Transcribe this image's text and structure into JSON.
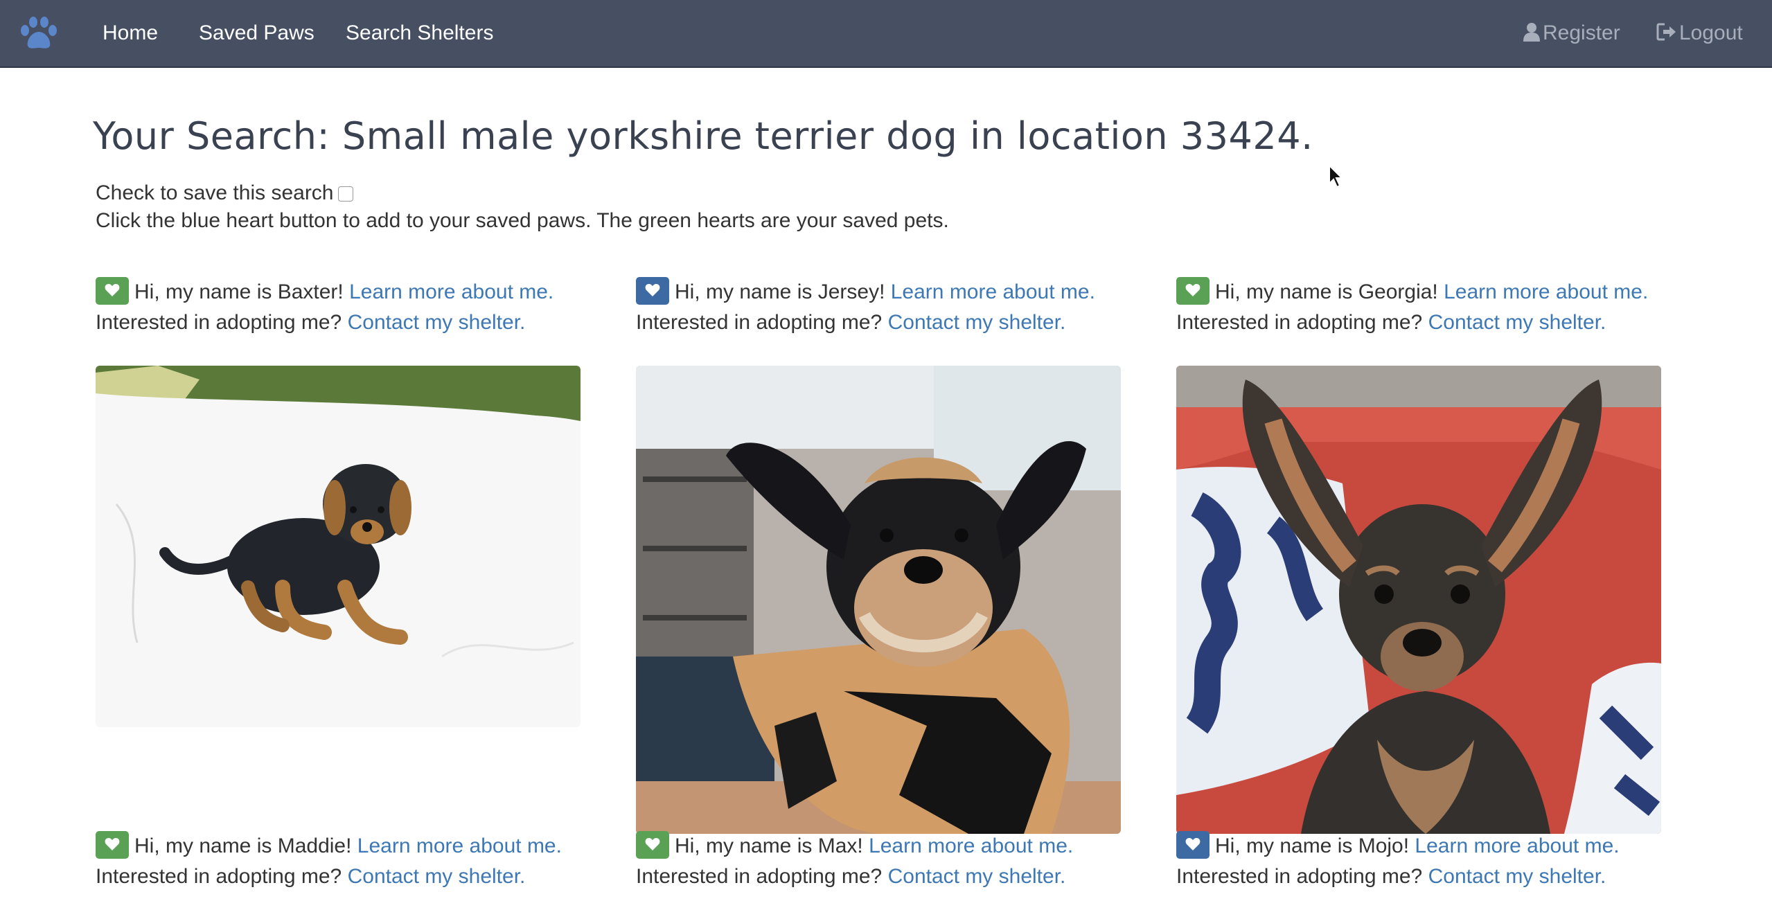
{
  "nav": {
    "items": [
      {
        "label": "Home"
      },
      {
        "label": "Saved Paws"
      },
      {
        "label": "Search Shelters"
      }
    ],
    "register_label": "Register",
    "logout_label": "Logout"
  },
  "search": {
    "title": "Your Search: Small male yorkshire terrier dog in location 33424.",
    "save_label": "Check to save this search",
    "save_checked": false,
    "instructions": "Click the blue heart button to add to your saved paws. The green hearts are your saved pets."
  },
  "common": {
    "learn_more": "Learn more about me.",
    "adopt_prompt": "Interested in adopting me?",
    "contact": "Contact my shelter."
  },
  "pets": [
    {
      "greeting": "Hi, my name is Baxter!",
      "saved": true,
      "heart_color": "#5aa156",
      "photo": "puppy lying on white blanket"
    },
    {
      "greeting": "Hi, my name is Jersey!",
      "saved": false,
      "heart_color": "#3e6aa3",
      "photo": "shaggy black and tan terrier"
    },
    {
      "greeting": "Hi, my name is Georgia!",
      "saved": true,
      "heart_color": "#5aa156",
      "photo": "terrier on red couch"
    },
    {
      "greeting": "Hi, my name is Maddie!",
      "saved": true,
      "heart_color": "#5aa156"
    },
    {
      "greeting": "Hi, my name is Max!",
      "saved": true,
      "heart_color": "#5aa156"
    },
    {
      "greeting": "Hi, my name is Mojo!",
      "saved": false,
      "heart_color": "#3e6aa3"
    }
  ],
  "colors": {
    "navbar": "#474f63",
    "link": "#3d78b5",
    "saved_heart": "#5aa156",
    "unsaved_heart": "#3e6aa3"
  }
}
